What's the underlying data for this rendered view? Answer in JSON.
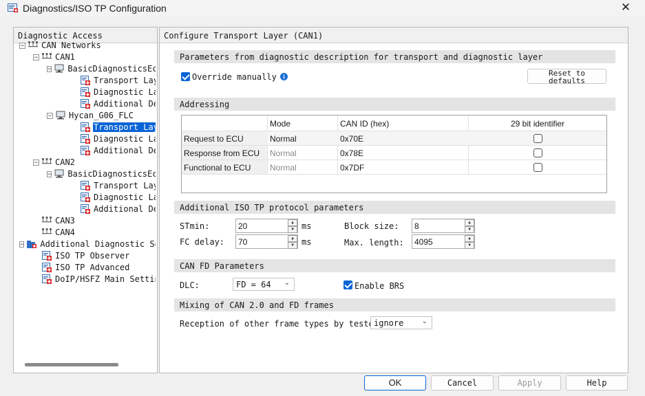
{
  "window": {
    "title": "Diagnostics/ISO TP Configuration",
    "close_symbol": "✕"
  },
  "left_panel": {
    "header": "Diagnostic Access",
    "tree": [
      {
        "label": "CAN Networks",
        "icon": "network-icon",
        "expander": "−"
      },
      {
        "label": "CAN1",
        "icon": "network-icon",
        "expander": "−"
      },
      {
        "label": "BasicDiagnosticsEc",
        "icon": "ecu-icon",
        "expander": "−"
      },
      {
        "label": "Transport Layer",
        "icon": "config-page-icon"
      },
      {
        "label": "Diagnostic Layer",
        "icon": "config-page-icon"
      },
      {
        "label": "Additional Desc",
        "icon": "config-page-icon"
      },
      {
        "label": "Hycan_G06_FLC",
        "icon": "ecu-icon",
        "expander": "−"
      },
      {
        "label": "Transport Layer",
        "icon": "config-page-icon",
        "selected": true
      },
      {
        "label": "Diagnostic Layer",
        "icon": "config-page-icon"
      },
      {
        "label": "Additional Desc",
        "icon": "config-page-icon"
      },
      {
        "label": "CAN2",
        "icon": "network-icon",
        "expander": "−"
      },
      {
        "label": "BasicDiagnosticsEc",
        "icon": "ecu-icon",
        "expander": "−"
      },
      {
        "label": "Transport Layer",
        "icon": "config-page-icon"
      },
      {
        "label": "Diagnostic Layer",
        "icon": "config-page-icon"
      },
      {
        "label": "Additional Desc",
        "icon": "config-page-icon"
      },
      {
        "label": "CAN3",
        "icon": "network-icon"
      },
      {
        "label": "CAN4",
        "icon": "network-icon"
      },
      {
        "label": "Additional Diagnostic Se",
        "icon": "folder-icon",
        "expander": "−"
      },
      {
        "label": "ISO TP Observer",
        "icon": "config-page-icon"
      },
      {
        "label": "ISO TP Advanced",
        "icon": "config-page-icon"
      },
      {
        "label": "DoIP/HSFZ Main Settin",
        "icon": "config-page-icon"
      }
    ]
  },
  "right_panel": {
    "header": "Configure Transport Layer (CAN1)",
    "params_section": {
      "title": "Parameters from diagnostic description for transport and diagnostic layer",
      "override_label": "Override manually",
      "override_checked": true,
      "reset_button": "Reset to\ndefaults"
    },
    "addressing": {
      "title": "Addressing",
      "columns": [
        "Mode",
        "CAN ID (hex)",
        "29 bit identifier"
      ],
      "rows": [
        {
          "label": "Request to ECU",
          "mode": "Normal",
          "mode_enabled": true,
          "can_id": "0x70E",
          "bit29": false
        },
        {
          "label": "Response from ECU",
          "mode": "Normal",
          "mode_enabled": false,
          "can_id": "0x78E",
          "bit29": false
        },
        {
          "label": "Functional to ECU",
          "mode": "Normal",
          "mode_enabled": false,
          "can_id": "0x7DF",
          "bit29": false
        }
      ]
    },
    "iso_tp": {
      "title": "Additional ISO TP protocol parameters",
      "stmin_label": "STmin:",
      "stmin_value": "20",
      "stmin_unit": "ms",
      "fc_delay_label": "FC delay:",
      "fc_delay_value": "70",
      "fc_delay_unit": "ms",
      "block_size_label": "Block size:",
      "block_size_value": "8",
      "max_length_label": "Max. length:",
      "max_length_value": "4095"
    },
    "can_fd": {
      "title": "CAN FD Parameters",
      "dlc_label": "DLC:",
      "dlc_value": "FD = 64",
      "brs_label": "Enable BRS",
      "brs_checked": true
    },
    "mixing": {
      "title": "Mixing of CAN 2.0 and FD frames",
      "reception_label": "Reception of other frame types by tester:",
      "reception_value": "ignore"
    }
  },
  "footer": {
    "ok": "OK",
    "cancel": "Cancel",
    "apply": "Apply",
    "help": "Help"
  },
  "colors": {
    "accent": "#0a64d6",
    "section_bg": "#e4e4e4",
    "panel_bg": "#f0f0f0"
  }
}
